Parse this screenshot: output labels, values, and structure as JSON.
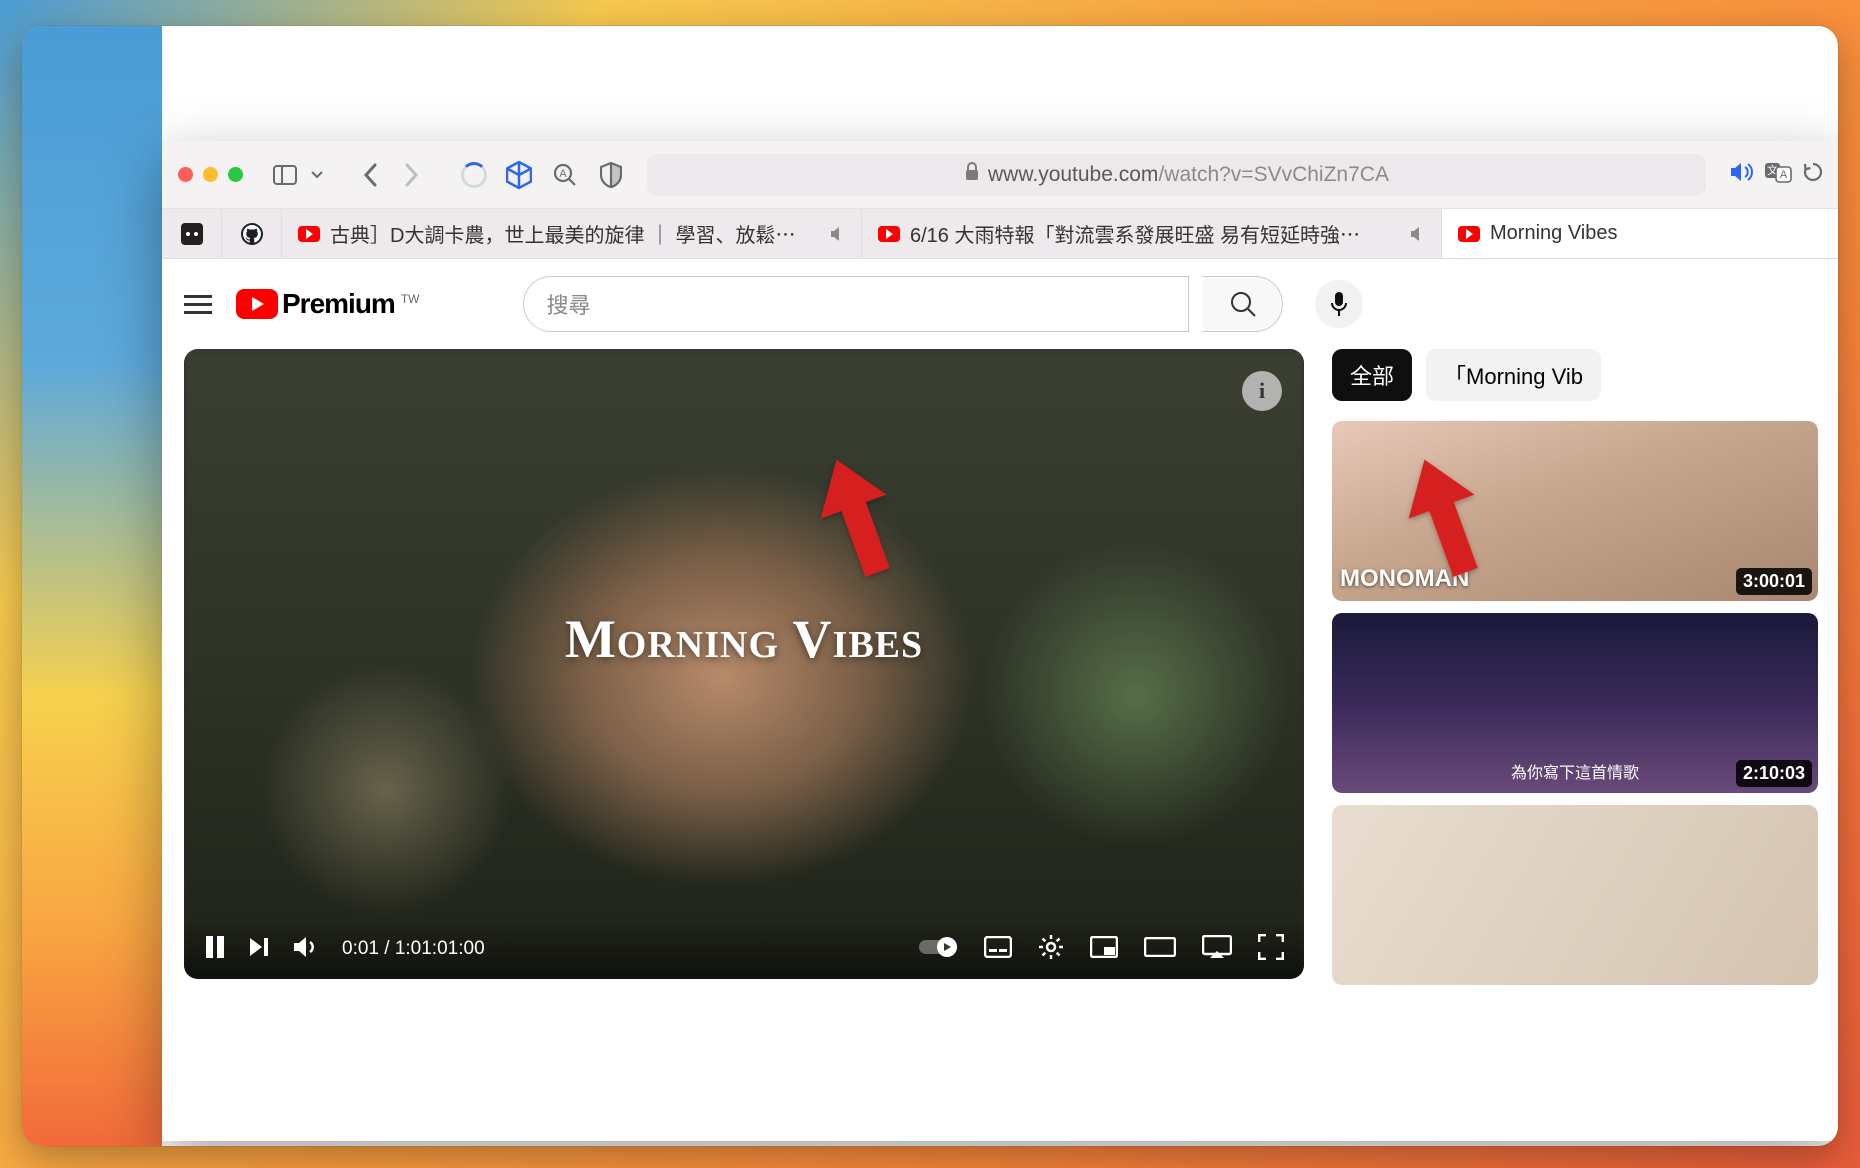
{
  "browser": {
    "url_host": "www.youtube.com",
    "url_path": "/watch?v=SVvChiZn7CA",
    "tabs": [
      {
        "label": "古典］D大調卡農，世上最美的旋律 ｜ 學習、放鬆⋯"
      },
      {
        "label": "6/16 大雨特報「對流雲系發展旺盛 易有短延時強⋯"
      },
      {
        "label": "Morning Vibes"
      }
    ]
  },
  "masthead": {
    "logo_text": "Premium",
    "logo_region": "TW",
    "search_placeholder": "搜尋"
  },
  "player": {
    "overlay_title": "Morning Vibes",
    "time_current": "0:01",
    "time_total": "1:01:01:00"
  },
  "chips": {
    "all": "全部",
    "related": "「Morning Vib"
  },
  "thumbs": [
    {
      "overlay": "MONOMAN",
      "duration": "3:00:01"
    },
    {
      "overlay": "為你寫下這首情歌",
      "duration": "2:10:03"
    },
    {
      "overlay": "",
      "duration": ""
    }
  ]
}
